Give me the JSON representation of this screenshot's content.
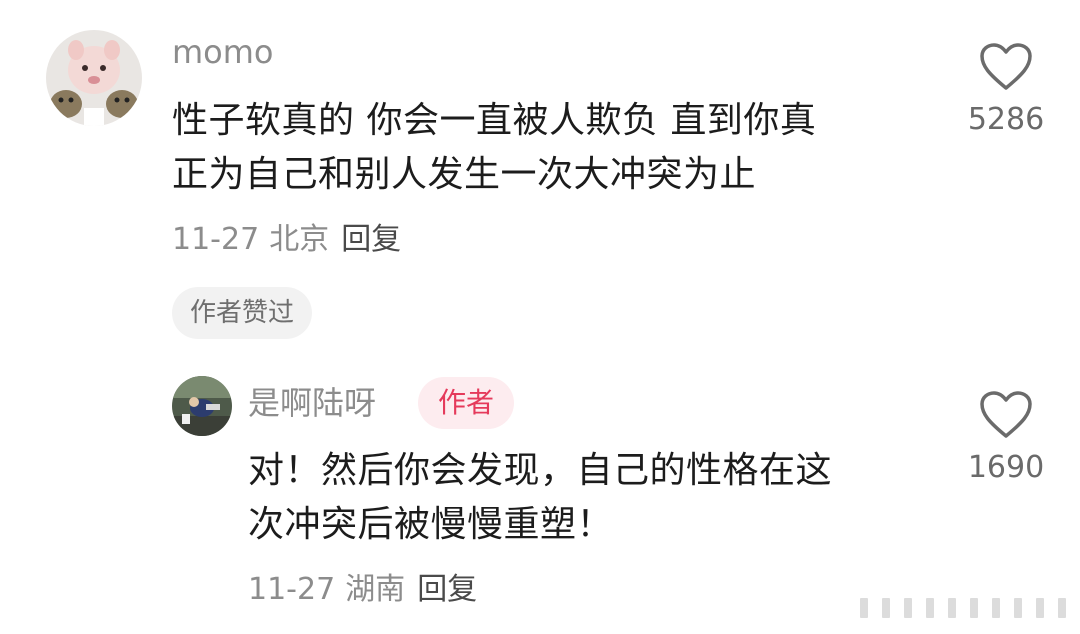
{
  "comment": {
    "username": "momo",
    "text_lines": [
      "性子软真的 你会一直被人欺负 直到你真",
      "正为自己和别人发生一次大冲突为止"
    ],
    "date": "11-27",
    "location": "北京",
    "reply_label": "回复",
    "likes": "5286",
    "author_liked_label": "作者赞过"
  },
  "reply": {
    "username": "是啊陆呀",
    "author_badge": "作者",
    "text_lines": [
      "对！然后你会发现，自己的性格在这",
      "次冲突后被慢慢重塑！"
    ],
    "date": "11-27",
    "location": "湖南",
    "reply_label": "回复",
    "likes": "1690"
  },
  "icons": {
    "like": "heart-outline-icon",
    "watermark": "watermark-bars-icon"
  },
  "colors": {
    "muted_text": "#8c8c8c",
    "body_text": "#1c1c1c",
    "author_badge_bg": "#fdecef",
    "author_badge_text": "#e53a5b",
    "pill_bg": "#f2f2f2"
  }
}
